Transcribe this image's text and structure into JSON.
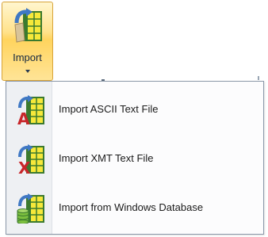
{
  "ribbon": {
    "import_button": {
      "label": "Import",
      "icon": "import-table-icon"
    }
  },
  "menu": {
    "items": [
      {
        "label": "Import ASCII Text File",
        "icon": "ascii-text-file-icon"
      },
      {
        "label": "Import XMT Text File",
        "icon": "xmt-text-file-icon"
      },
      {
        "label": "Import from Windows Database",
        "icon": "windows-database-icon"
      }
    ]
  },
  "colors": {
    "button_highlight": "#ffd45e",
    "menu_border": "#8a97a8",
    "gutter": "#eef0f3",
    "table_yellow": "#f6e83a",
    "table_green": "#3b7a2e",
    "arrow_blue": "#3f78c4",
    "letter_red": "#c8262a",
    "database_green": "#7cbf3e"
  }
}
